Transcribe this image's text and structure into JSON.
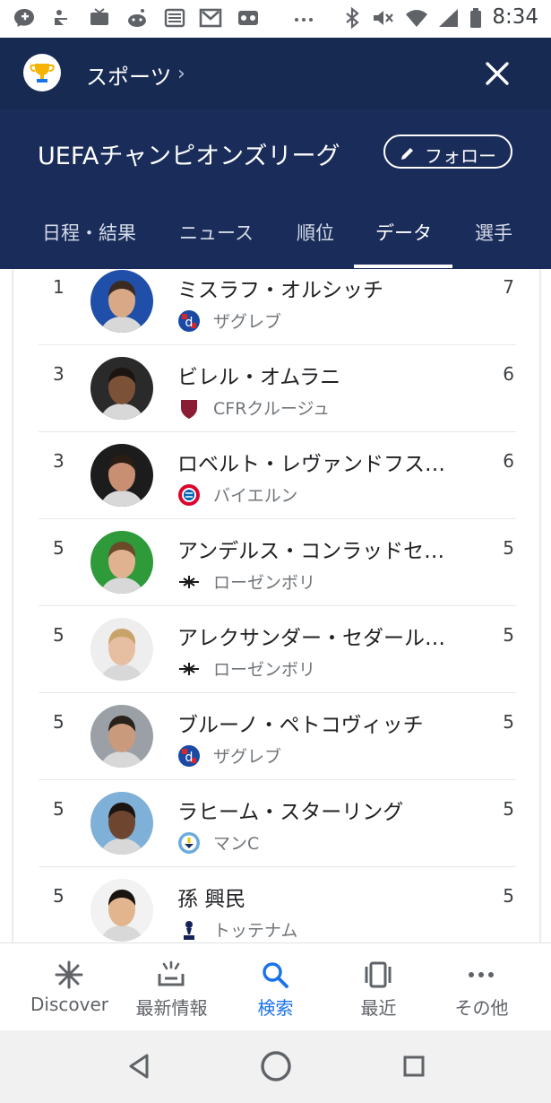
{
  "status_bar": {
    "time": "8:34",
    "icons": [
      "messenger-icon",
      "app-icon",
      "tv-icon",
      "reddit-icon",
      "news-icon",
      "gmail-icon",
      "voicemail-icon",
      "more-dots-icon",
      "bluetooth-icon",
      "mute-icon",
      "wifi-icon",
      "signal-icon",
      "battery-icon"
    ]
  },
  "header": {
    "category": "スポーツ",
    "league": "UEFAチャンピオンズリーグ",
    "follow_label": "フォロー",
    "tabs": [
      {
        "label": "日程・結果",
        "active": false
      },
      {
        "label": "ニュース",
        "active": false
      },
      {
        "label": "順位",
        "active": false
      },
      {
        "label": "データ",
        "active": true
      },
      {
        "label": "選手",
        "active": false
      }
    ]
  },
  "scorers": [
    {
      "rank": "1",
      "name": "ミスラフ・オルシッチ",
      "team": "ザグレブ",
      "goals": "7",
      "crest": "dinamo-zagreb-crest",
      "photo_bg": "#1f4fa8",
      "skin": "#d9a987",
      "hair": "#3b2a1f"
    },
    {
      "rank": "3",
      "name": "ビレル・オムラニ",
      "team": "CFRクルージュ",
      "goals": "6",
      "crest": "cfr-cluj-crest",
      "photo_bg": "#2a2a2a",
      "skin": "#7b5238",
      "hair": "#1b1410"
    },
    {
      "rank": "3",
      "name": "ロベルト・レヴァンドフス…",
      "team": "バイエルン",
      "goals": "6",
      "crest": "bayern-crest",
      "photo_bg": "#1c1c1c",
      "skin": "#c98f73",
      "hair": "#2a1d14"
    },
    {
      "rank": "5",
      "name": "アンデルス・コンラッドセ…",
      "team": "ローゼンボリ",
      "goals": "5",
      "crest": "rosenborg-crest",
      "photo_bg": "#2f9a3a",
      "skin": "#e0b290",
      "hair": "#6b4a2a"
    },
    {
      "rank": "5",
      "name": "アレクサンダー・セダール…",
      "team": "ローゼンボリ",
      "goals": "5",
      "crest": "rosenborg-crest",
      "photo_bg": "#eeeeee",
      "skin": "#e6bea2",
      "hair": "#c9a46a"
    },
    {
      "rank": "5",
      "name": "ブルーノ・ペトコヴィッチ",
      "team": "ザグレブ",
      "goals": "5",
      "crest": "dinamo-zagreb-crest",
      "photo_bg": "#9aa0a6",
      "skin": "#c99a7c",
      "hair": "#2b211b"
    },
    {
      "rank": "5",
      "name": "ラヒーム・スターリング",
      "team": "マンC",
      "goals": "5",
      "crest": "man-city-crest",
      "photo_bg": "#7fb0d8",
      "skin": "#6e4630",
      "hair": "#1c1410"
    },
    {
      "rank": "5",
      "name": "孫 興民",
      "team": "トッテナム",
      "goals": "5",
      "crest": "tottenham-crest",
      "photo_bg": "#f2f2f2",
      "skin": "#e2b58f",
      "hair": "#1a1411"
    }
  ],
  "bottom_nav": [
    {
      "label": "Discover",
      "icon": "discover-icon",
      "active": false
    },
    {
      "label": "最新情報",
      "icon": "updates-icon",
      "active": false
    },
    {
      "label": "検索",
      "icon": "search-icon",
      "active": true
    },
    {
      "label": "最近",
      "icon": "recent-icon",
      "active": false
    },
    {
      "label": "その他",
      "icon": "more-icon",
      "active": false
    }
  ],
  "system_nav": [
    "back-icon",
    "home-icon",
    "overview-icon"
  ],
  "colors": {
    "header_bg": "#1a2d5a",
    "header_top_bg": "#172a52",
    "accent": "#1a73e8",
    "text_secondary": "#70757a"
  }
}
